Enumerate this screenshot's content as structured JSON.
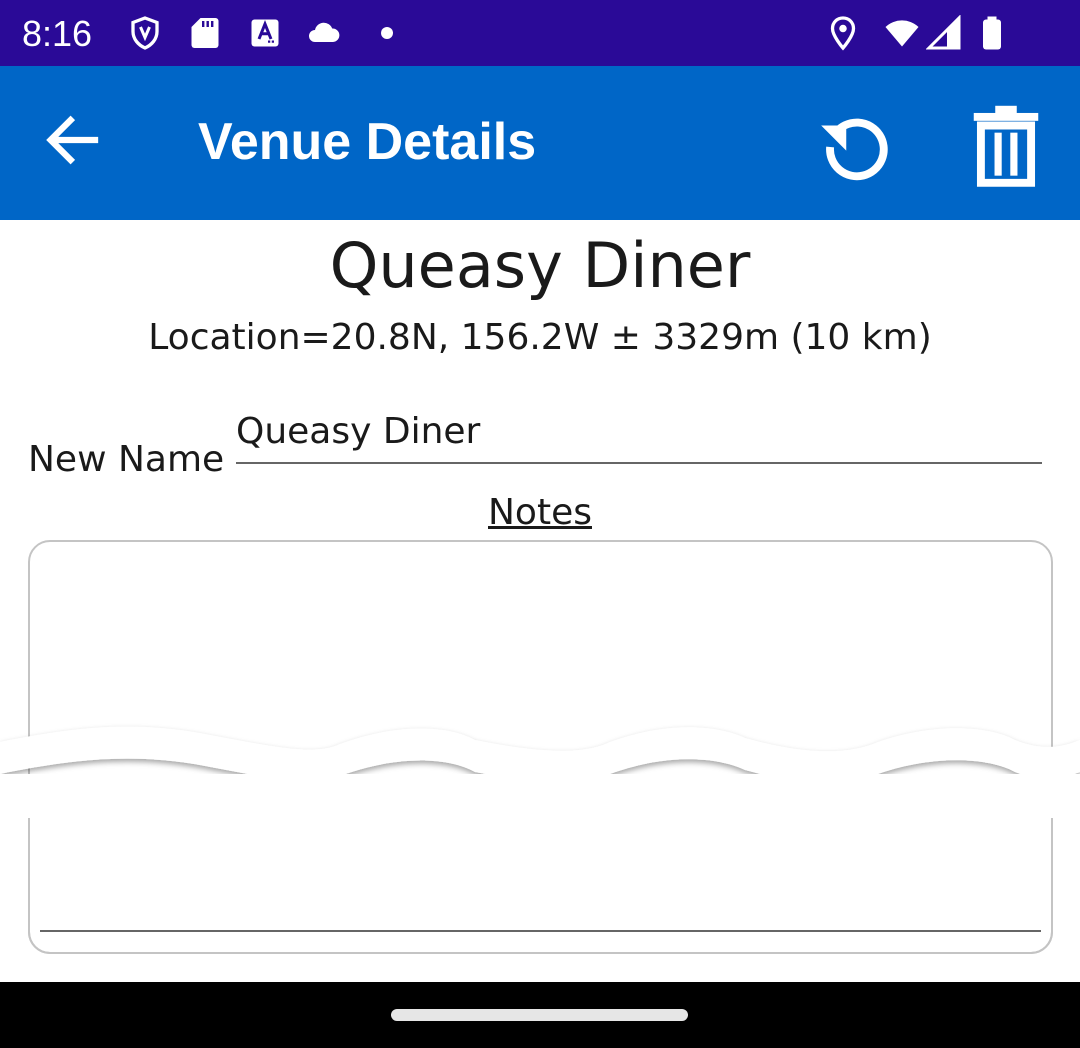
{
  "status_bar": {
    "time": "8:16",
    "icons": [
      "shield-icon",
      "sd-card-icon",
      "accessibility-icon",
      "cloud-icon",
      "dot-icon",
      "location-icon",
      "wifi-icon",
      "signal-icon",
      "battery-icon"
    ]
  },
  "app_bar": {
    "title": "Venue Details",
    "background_color": "#0066c7",
    "actions": [
      "back-arrow-icon",
      "refresh-icon",
      "trash-icon"
    ]
  },
  "venue": {
    "name": "Queasy Diner",
    "location": "Location=20.8N, 156.2W ± 3329m (10 km)"
  },
  "form": {
    "new_name_label": "New Name",
    "new_name_value": "Queasy Diner",
    "notes_label": "Notes",
    "notes_value": ""
  },
  "colors": {
    "status_bar": "#2a0a97",
    "app_bar": "#0066c7",
    "text": "#1a1a1a"
  }
}
